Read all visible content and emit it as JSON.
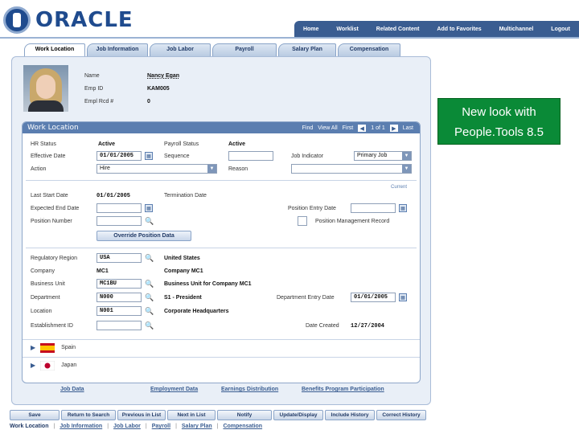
{
  "brand": {
    "name": "ORACLE"
  },
  "topnav": [
    "Home",
    "Worklist",
    "Related Content",
    "Add to Favorites",
    "Multichannel",
    "Logout"
  ],
  "tabs": [
    "Work Location",
    "Job Information",
    "Job Labor",
    "Payroll",
    "Salary Plan",
    "Compensation"
  ],
  "employee": {
    "name_label": "Name",
    "name": "Nancy Egan",
    "id_label": "Emp ID",
    "id": "KAM005",
    "rcd_label": "Empl Rcd #",
    "rcd": "0"
  },
  "work_location": {
    "title": "Work Location",
    "nav": {
      "find": "Find",
      "view_all": "View All",
      "first": "First",
      "pos": "1 of 1",
      "last": "Last"
    },
    "hr_status_label": "HR Status",
    "hr_status": "Active",
    "payroll_status_label": "Payroll Status",
    "payroll_status": "Active",
    "eff_date_label": "Effective Date",
    "eff_date": "01/01/2005",
    "sequence_label": "Sequence",
    "job_indicator_label": "Job Indicator",
    "job_indicator": "Primary Job",
    "action_label": "Action",
    "action": "Hire",
    "reason_label": "Reason",
    "current": "Current",
    "last_start_label": "Last Start Date",
    "last_start": "01/01/2005",
    "termination_label": "Termination Date",
    "expected_end_label": "Expected End Date",
    "position_entry_label": "Position Entry Date",
    "position_number_label": "Position Number",
    "position_mgmt_label": "Position Management Record",
    "override_button": "Override Position Data",
    "reg_region_label": "Regulatory Region",
    "reg_region": "USA",
    "reg_region_desc": "United States",
    "company_label": "Company",
    "company": "MC1",
    "company_desc": "Company MC1",
    "bu_label": "Business Unit",
    "bu": "MC1BU",
    "bu_desc": "Business Unit for Company MC1",
    "dept_label": "Department",
    "dept": "N000",
    "dept_desc": "S1 - President",
    "dept_entry_label": "Department Entry Date",
    "dept_entry": "01/01/2005",
    "location_label": "Location",
    "location": "N001",
    "location_desc": "Corporate Headquarters",
    "establishment_label": "Establishment ID",
    "date_created_label": "Date Created",
    "date_created": "12/27/2004",
    "languages": [
      "Spain",
      "Japan"
    ]
  },
  "sublinks": [
    "Job Data",
    "Employment Data",
    "Earnings Distribution",
    "Benefits Program Participation"
  ],
  "toolbar": [
    "Save",
    "Return to Search",
    "Previous in List",
    "Next in List",
    "Notify",
    "Update/Display",
    "Include History",
    "Correct History"
  ],
  "bottom_links": [
    "Work Location",
    "Job Information",
    "Job Labor",
    "Payroll",
    "Salary Plan",
    "Compensation"
  ],
  "callout": {
    "line1": "New look with",
    "line2": "People.Tools 8.5"
  },
  "colors": {
    "brand_blue": "#1f4b8e",
    "nav_bar": "#3a5d91",
    "panel_header": "#5b7eb0",
    "callout_green": "#0a8a37"
  }
}
